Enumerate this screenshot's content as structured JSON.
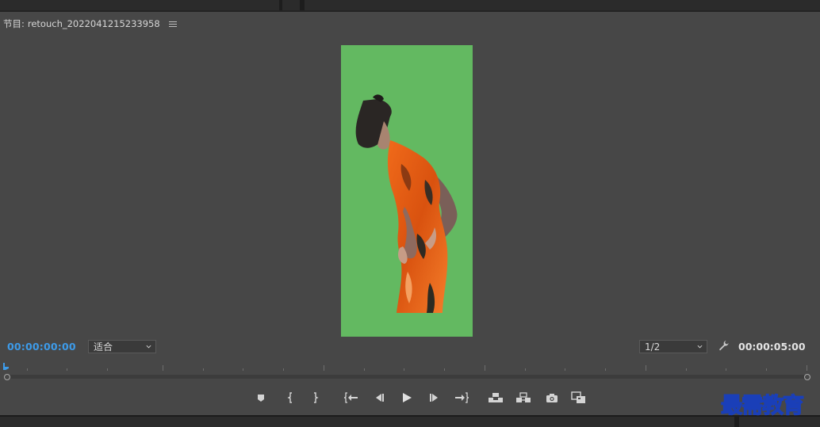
{
  "panel": {
    "title_prefix": "节目:",
    "sequence_name": "retouch_2022041215233958",
    "menu_icon": "hamburger-menu-icon"
  },
  "playback": {
    "current_timecode": "00:00:00:00",
    "duration_timecode": "00:00:05:00"
  },
  "zoom": {
    "selected": "适合"
  },
  "resolution": {
    "selected": "1/2"
  },
  "transport": {
    "buttons": [
      "add-marker-icon",
      "mark-in-icon",
      "mark-out-icon",
      "go-to-in-icon",
      "step-back-icon",
      "play-icon",
      "step-forward-icon",
      "go-to-out-icon",
      "lift-icon",
      "extract-icon",
      "export-frame-icon",
      "comparison-view-icon"
    ]
  },
  "preview": {
    "background_color": "#63b961",
    "subject": "person-silhouette"
  },
  "colors": {
    "timecode_accent": "#3d9be9",
    "panel_bg": "#474747"
  },
  "watermark": {
    "text": "最需教育"
  }
}
